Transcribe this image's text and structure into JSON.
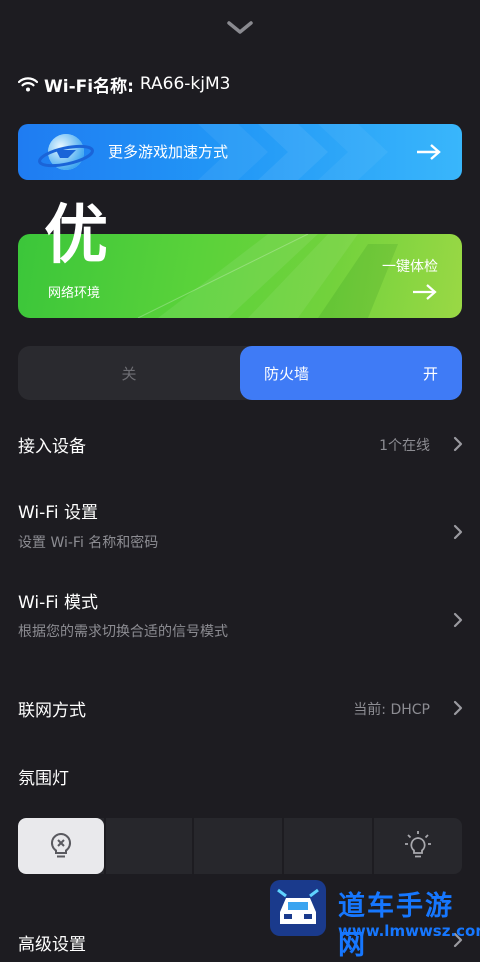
{
  "wifi": {
    "label": "Wi-Fi名称:",
    "name": "RA66-kjM3"
  },
  "boost": {
    "text": "更多游戏加速方式",
    "arrow": "⟶"
  },
  "network": {
    "grade": "优",
    "subtitle": "网络环境",
    "check_label": "一键体检",
    "arrow": "⟶"
  },
  "firewall": {
    "off_label": "关",
    "label": "防火墙",
    "state": "开"
  },
  "rows": [
    {
      "title": "接入设备",
      "value": "1个在线"
    },
    {
      "title": "Wi-Fi 设置",
      "subtitle": "设置 Wi-Fi 名称和密码"
    },
    {
      "title": "Wi-Fi 模式",
      "subtitle": "根据您的需求切换合适的信号模式"
    },
    {
      "title": "联网方式",
      "value": "当前: DHCP"
    },
    {
      "title": "氛围灯"
    }
  ],
  "advanced": {
    "title": "高级设置"
  },
  "watermark": {
    "name": "道车手游网",
    "url": "www.lmwwsz.com"
  },
  "colors": {
    "background": "#1d1c21",
    "accent_blue": "#3f7bf6",
    "green": "#4fcc3a",
    "watermark": "#1677ff"
  },
  "icons": [
    "chevron-down-icon",
    "wifi-icon",
    "planet-icon",
    "arrow-right-icon",
    "chevron-right-icon",
    "bulb-off-icon",
    "bulb-on-icon"
  ]
}
